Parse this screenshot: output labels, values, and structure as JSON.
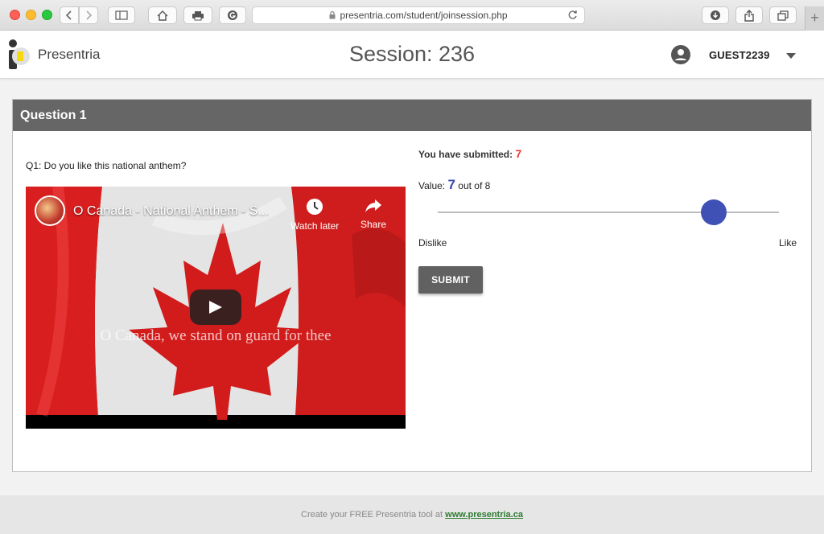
{
  "browser": {
    "url": "presentria.com/student/joinsession.php",
    "new_tab": "+"
  },
  "header": {
    "brand": "Presentria",
    "session_title": "Session: 236",
    "username": "GUEST2239"
  },
  "card": {
    "title": "Question 1",
    "question": "Q1: Do you like this national anthem?",
    "video": {
      "title": "O Canada - National Anthem - S...",
      "watch_later": "Watch later",
      "share": "Share",
      "lyric": "O Canada, we stand on guard for thee"
    },
    "submitted_label": "You have submitted: ",
    "submitted_value": "7",
    "value_label": "Value: ",
    "value": "7",
    "value_suffix": " out of 8",
    "slider": {
      "min": 1,
      "max": 8,
      "value": 7
    },
    "dislike_label": "Dislike",
    "like_label": "Like",
    "submit_label": "SUBMIT"
  },
  "footer": {
    "text": "Create your FREE Presentria tool at ",
    "link": "www.presentria.ca"
  },
  "colors": {
    "accent": "#3f51b5",
    "submitted_red": "#e53935",
    "header_gray": "#666666",
    "link_green": "#2e7d32"
  },
  "icons": {
    "back": "chevron-left-icon",
    "forward": "chevron-right-icon",
    "sidebar": "sidebar-icon",
    "home": "home-icon",
    "print": "print-icon",
    "extension": "grammarly-icon",
    "lock": "lock-icon",
    "reload": "reload-icon",
    "download": "download-icon",
    "share": "share-icon",
    "tabs": "tabs-icon",
    "account": "account-circle-icon",
    "caret": "caret-down-icon",
    "play": "play-icon",
    "clock": "clock-icon",
    "share_arrow": "share-arrow-icon"
  }
}
